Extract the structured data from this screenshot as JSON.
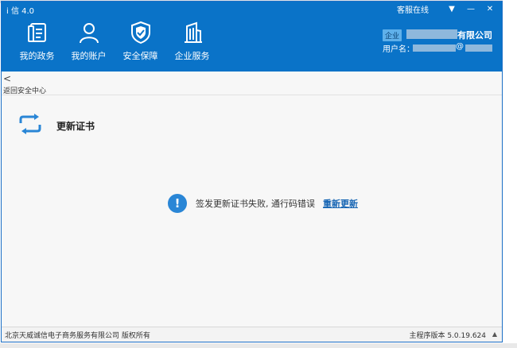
{
  "window": {
    "title": "i 信 4.0",
    "customer_service": "客服在线"
  },
  "nav": {
    "items": [
      {
        "label": "我的政务",
        "icon": "government-icon"
      },
      {
        "label": "我的账户",
        "icon": "user-icon"
      },
      {
        "label": "安全保障",
        "icon": "shield-icon"
      },
      {
        "label": "企业服务",
        "icon": "building-icon"
      }
    ]
  },
  "account": {
    "badge": "企业",
    "company_suffix": "有限公司",
    "user_label": "用户名：",
    "user_at": "@"
  },
  "breadcrumb": {
    "back_label": "返回安全中心"
  },
  "section": {
    "title": "更新证书"
  },
  "message": {
    "text": "签发更新证书失败, 通行码错误",
    "retry": "重新更新"
  },
  "footer": {
    "copyright": "北京天威诚信电子商务服务有限公司 版权所有",
    "version": "主程序版本 5.0.19.624"
  },
  "colors": {
    "header": "#0a73c8",
    "link": "#1564b3",
    "info": "#2a86d6"
  }
}
